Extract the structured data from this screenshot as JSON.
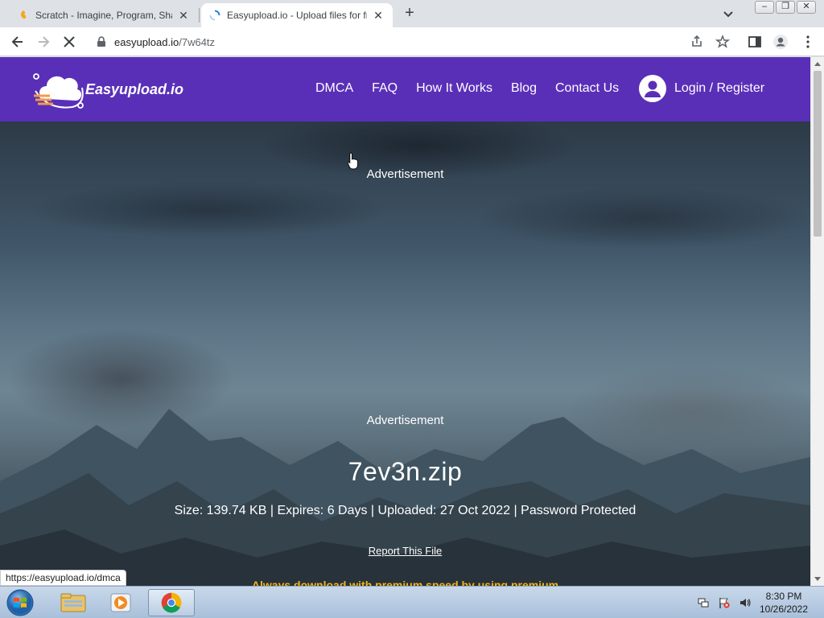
{
  "browser": {
    "tabs": [
      {
        "title": "Scratch - Imagine, Program, Share",
        "active": false
      },
      {
        "title": "Easyupload.io - Upload files for free",
        "active": true
      }
    ],
    "new_tab_label": "+",
    "url_host": "easyupload.io",
    "url_path": "/7w64tz",
    "status_url": "https://easyupload.io/dmca"
  },
  "site": {
    "brand": "Easyupload.io",
    "nav": [
      "DMCA",
      "FAQ",
      "How It Works",
      "Blog",
      "Contact Us"
    ],
    "login_label": "Login / Register",
    "brand_color": "#5a2fb8"
  },
  "content": {
    "ad_label_top": "Advertisement",
    "ad_label_bottom": "Advertisement",
    "file_name": "7ev3n.zip",
    "file_info": "Size: 139.74 KB | Expires: 6 Days | Uploaded: 27 Oct 2022 | Password Protected",
    "report_label": "Report This File",
    "premium_notice": "Always download with premium speed by using premium"
  },
  "taskbar": {
    "time": "8:30 PM",
    "date": "10/26/2022"
  }
}
